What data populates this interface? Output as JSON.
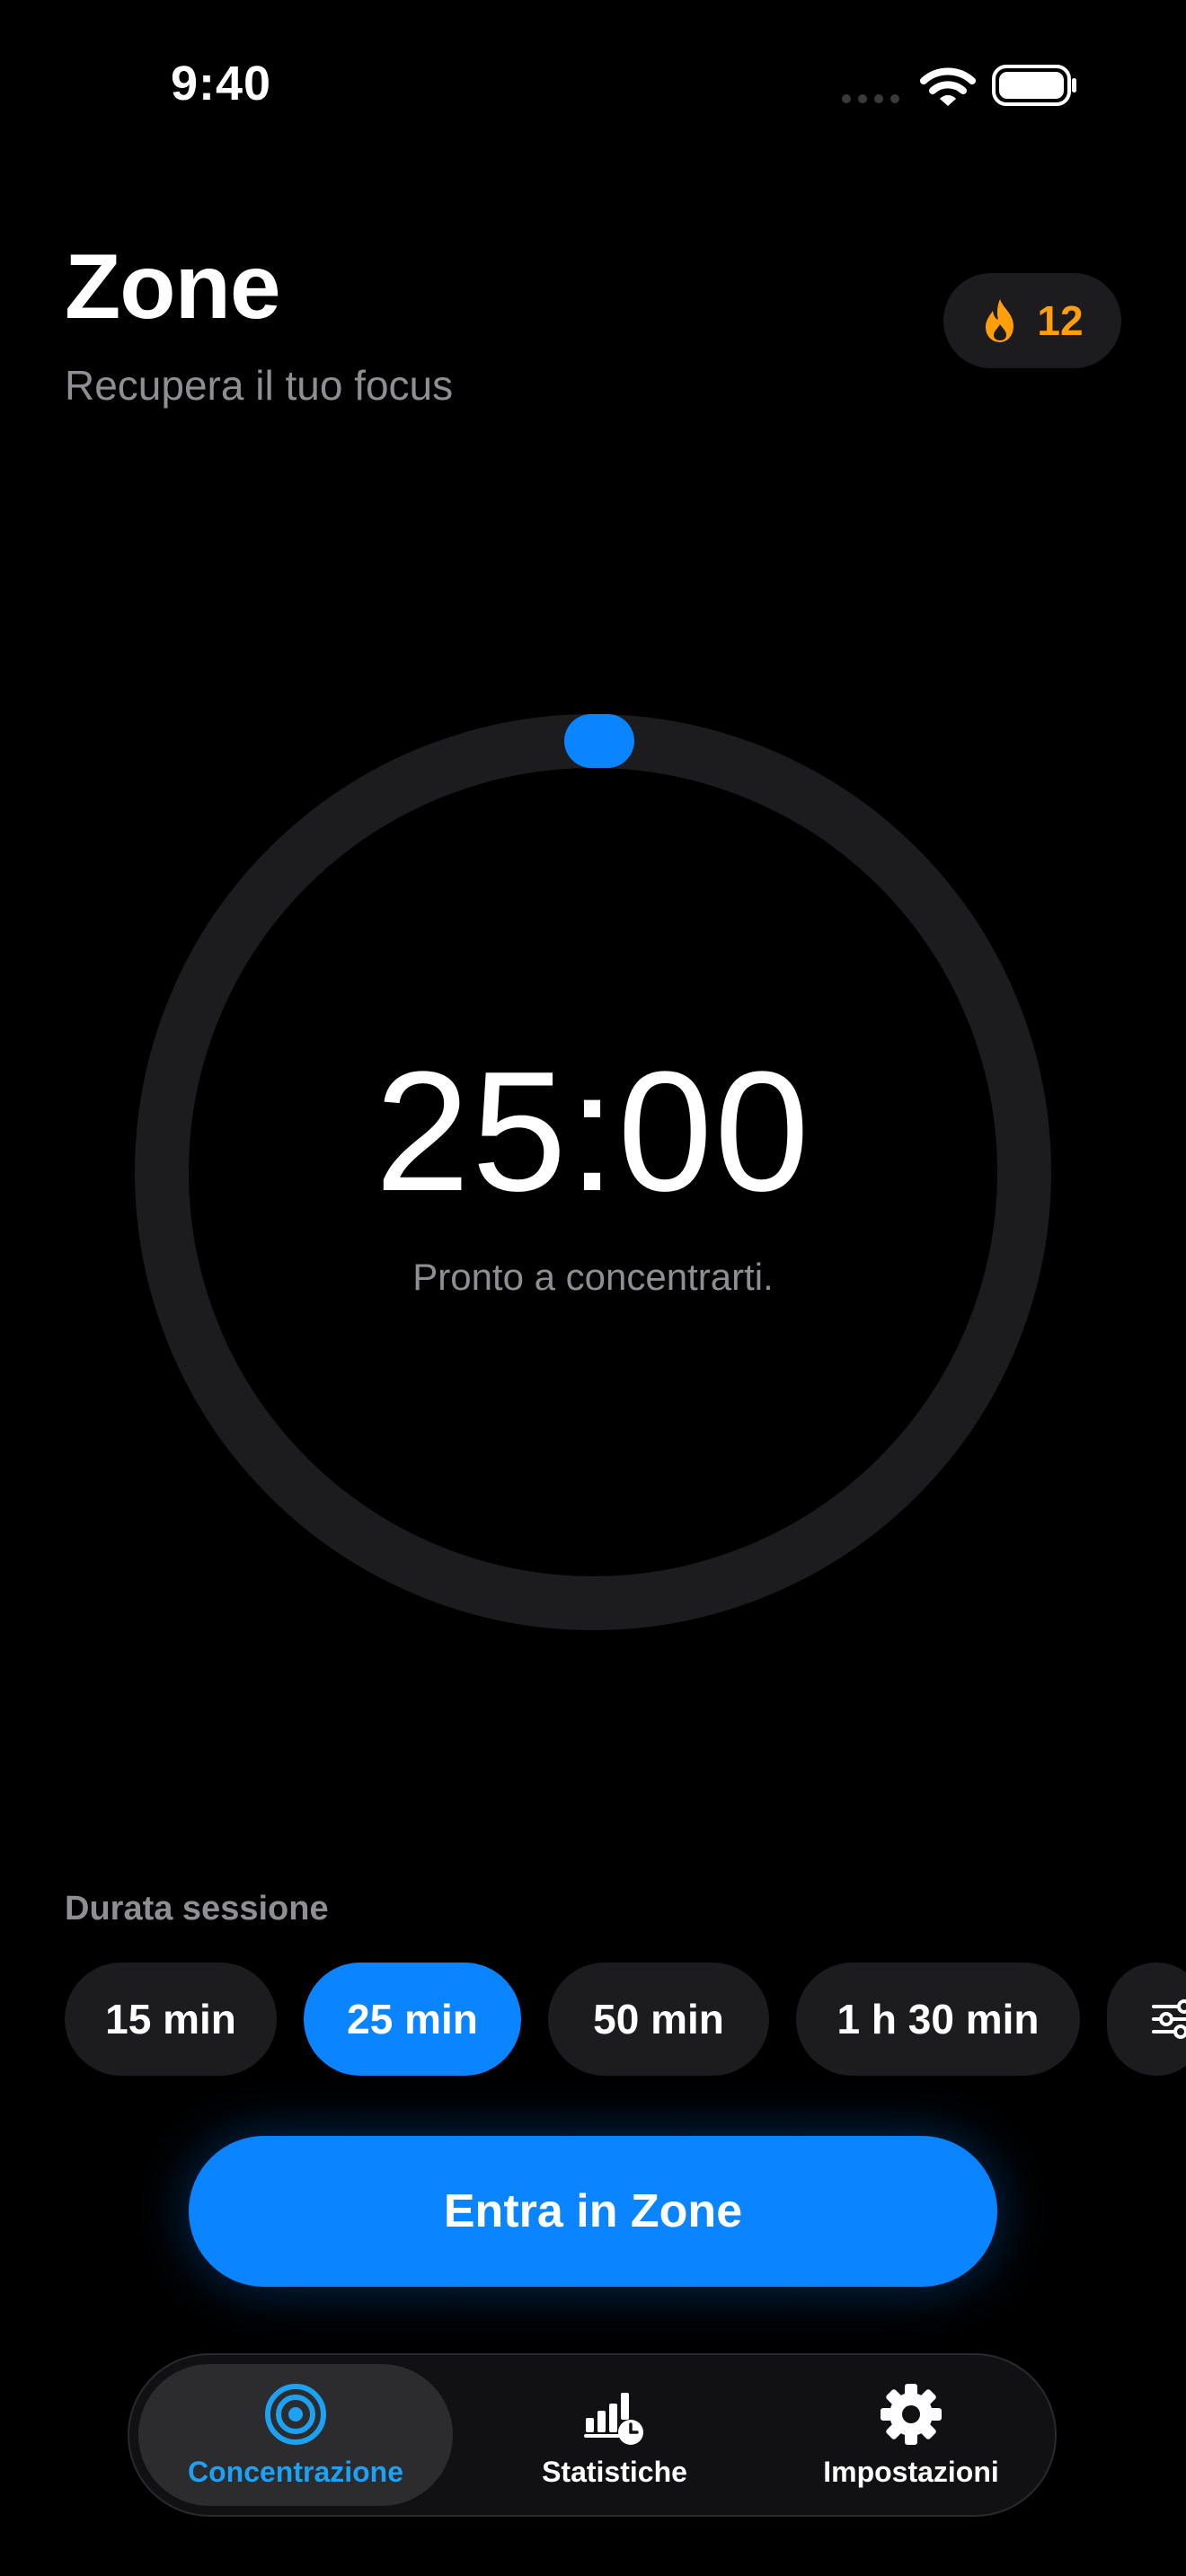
{
  "status_bar": {
    "time": "9:40"
  },
  "header": {
    "title": "Zone",
    "subtitle": "Recupera il tuo focus"
  },
  "streak": {
    "count": "12",
    "icon": "flame-icon",
    "color": "#ff9f0a"
  },
  "timer": {
    "value": "25:00",
    "status": "Pronto a concentrarti.",
    "progress": 0.0
  },
  "duration": {
    "label": "Durata sessione",
    "options": [
      {
        "label": "15 min"
      },
      {
        "label": "25 min",
        "selected": true
      },
      {
        "label": "50 min"
      },
      {
        "label": "1 h 30 min"
      }
    ],
    "custom_icon": "sliders-icon"
  },
  "cta": {
    "label": "Entra in Zone"
  },
  "tab_bar": {
    "items": [
      {
        "label": "Concentrazione",
        "icon": "target-icon",
        "active": true
      },
      {
        "label": "Statistiche",
        "icon": "chart-clock-icon"
      },
      {
        "label": "Impostazioni",
        "icon": "gear-icon"
      }
    ]
  },
  "colors": {
    "accent": "#0a84ff",
    "background": "#000000",
    "surface": "#1c1c1e",
    "streak": "#ff9f0a"
  }
}
